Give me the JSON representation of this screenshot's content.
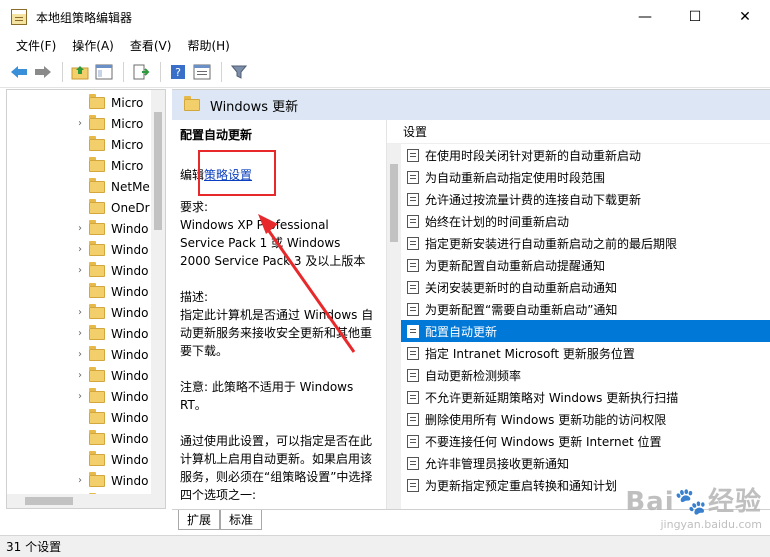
{
  "window": {
    "title": "本地组策略编辑器",
    "controls": {
      "minimize": "—",
      "maximize": "☐",
      "close": "✕"
    }
  },
  "menu": [
    {
      "label": "文件(F)"
    },
    {
      "label": "操作(A)"
    },
    {
      "label": "查看(V)"
    },
    {
      "label": "帮助(H)"
    }
  ],
  "toolbar": {
    "icons": [
      "back-arrow-icon",
      "forward-arrow-icon",
      "up-folder-icon",
      "show-hide-tree-icon",
      "export-list-icon",
      "help-icon",
      "properties-icon",
      "filter-icon"
    ]
  },
  "tree": {
    "items": [
      {
        "label": "Micro",
        "expandable": false
      },
      {
        "label": "Micro",
        "expandable": true
      },
      {
        "label": "Micro",
        "expandable": false
      },
      {
        "label": "Micro",
        "expandable": false
      },
      {
        "label": "NetMe",
        "expandable": false
      },
      {
        "label": "OneDr",
        "expandable": false
      },
      {
        "label": "Windo",
        "expandable": true
      },
      {
        "label": "Windo",
        "expandable": true
      },
      {
        "label": "Windo",
        "expandable": true
      },
      {
        "label": "Windo",
        "expandable": false
      },
      {
        "label": "Windo",
        "expandable": true
      },
      {
        "label": "Windo",
        "expandable": true
      },
      {
        "label": "Windo",
        "expandable": true
      },
      {
        "label": "Windo",
        "expandable": true
      },
      {
        "label": "Windo",
        "expandable": true
      },
      {
        "label": "Windo",
        "expandable": false
      },
      {
        "label": "Windo",
        "expandable": false
      },
      {
        "label": "Windo",
        "expandable": false
      },
      {
        "label": "Windo",
        "expandable": true
      },
      {
        "label": "Windo",
        "expandable": false
      }
    ],
    "selected_index": 19
  },
  "content": {
    "header_title": "Windows 更新",
    "description": {
      "policy_title": "配置自动更新",
      "edit_prefix": "编辑",
      "edit_link": "策略设置",
      "requirements_label": "要求:",
      "requirements_text": "Windows XP Professional Service Pack 1 或 Windows 2000 Service Pack 3 及以上版本",
      "description_label": "描述:",
      "description_text": "指定此计算机是否通过 Windows 自动更新服务来接收安全更新和其他重要下载。",
      "note_text": "注意: 此策略不适用于 Windows RT。",
      "usage_text": "通过使用此设置，可以指定是否在此计算机上启用自动更新。如果启用该服务，则必须在“组策略设置”中选择四个选项之一:"
    },
    "list_header": "设置",
    "settings": [
      "在使用时段关闭针对更新的自动重新启动",
      "为自动重新启动指定使用时段范围",
      "允许通过按流量计费的连接自动下载更新",
      "始终在计划的时间重新启动",
      "指定更新安装进行自动重新启动之前的最后期限",
      "为更新配置自动重新启动提醒通知",
      "关闭安装更新时的自动重新启动通知",
      "为更新配置“需要自动重新启动”通知",
      "配置自动更新",
      "指定 Intranet Microsoft 更新服务位置",
      "自动更新检测频率",
      "不允许更新延期策略对 Windows 更新执行扫描",
      "删除使用所有 Windows 更新功能的访问权限",
      "不要连接任何 Windows 更新 Internet 位置",
      "允许非管理员接收更新通知",
      "为更新指定预定重启转换和通知计划"
    ],
    "selected_setting_index": 8
  },
  "tabs": [
    {
      "label": "扩展"
    },
    {
      "label": "标准"
    }
  ],
  "status": {
    "text": "31 个设置"
  },
  "watermark": {
    "main": "Bai",
    "main_suffix": "经验",
    "sub": "jingyan.baidu.com"
  },
  "colors": {
    "selection": "#0078d7",
    "header_bg": "#dce6f4",
    "annotation_red": "#e8292b",
    "link": "#0b3fbf"
  }
}
